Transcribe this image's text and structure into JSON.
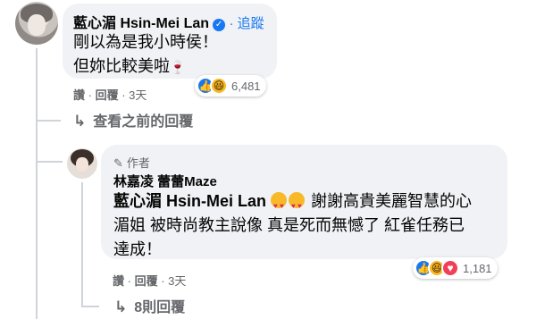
{
  "comment1": {
    "author": "藍心湄 Hsin-Mei Lan",
    "verified": "✓",
    "follow": "· 追蹤",
    "lines": [
      "剛以為是我小時侯！",
      "但妳比較美啦"
    ],
    "actions": {
      "like": "讚",
      "reply": "回覆",
      "time": "3天"
    },
    "reaction_count": "6,481",
    "reaction_icons": [
      "like-icon",
      "haha-icon"
    ]
  },
  "view_previous": "查看之前的回覆",
  "comment2": {
    "badge": "作者",
    "author": "林嘉凌 蕾蕾Maze",
    "mention": "藍心湄 Hsin-Mei Lan",
    "lines": [
      "謝謝高貴美麗智慧的心",
      "湄姐 被時尚教主說像 真是死而無憾了 紅雀任務已",
      "達成！"
    ],
    "actions": {
      "like": "讚",
      "reply": "回覆",
      "time": "3天"
    },
    "reaction_count": "1,181",
    "reaction_icons": [
      "like-icon",
      "haha-icon",
      "love-icon"
    ]
  },
  "more_replies": "8則回覆",
  "colors": {
    "accent": "#1877f2",
    "bubble": "#f0f2f5",
    "secondary_text": "#65676b"
  }
}
